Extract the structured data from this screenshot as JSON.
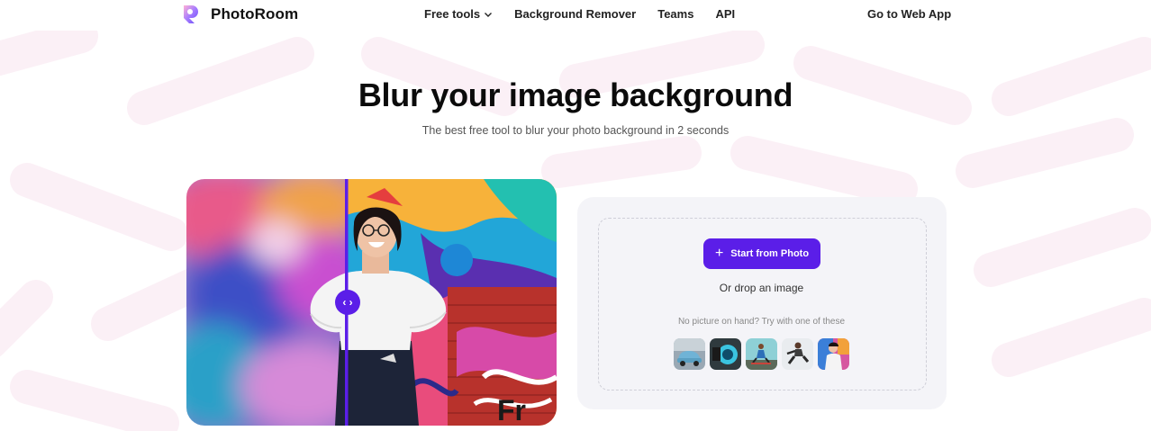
{
  "brand": {
    "name": "PhotoRoom",
    "accent": "#5b1ee8"
  },
  "nav": {
    "free_tools": "Free tools",
    "background_remover": "Background Remover",
    "teams": "Teams",
    "api": "API",
    "go_to_web_app": "Go to Web App"
  },
  "hero": {
    "title": "Blur your image background",
    "subtitle": "The best free tool to blur your photo background in 2 seconds"
  },
  "comparison": {
    "handle_icon": "chevron-left-right-icon",
    "handle_glyph": "‹ ›"
  },
  "upload": {
    "start_label": "Start from Photo",
    "plus_glyph": "+",
    "drop_label": "Or drop an image",
    "try_label": "No picture on hand? Try with one of these",
    "samples": [
      "car",
      "camera",
      "skateboarder",
      "runner",
      "woman"
    ]
  }
}
